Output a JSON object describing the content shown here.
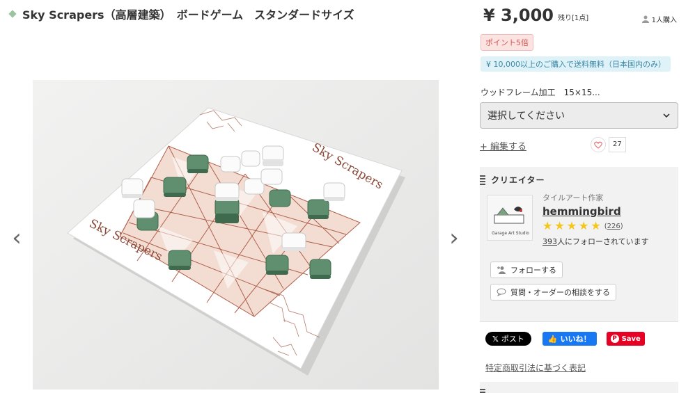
{
  "product": {
    "title": "Sky Scrapers（高層建築）　ボードゲーム　スタンダードサイズ"
  },
  "gallery": {
    "prev_glyph": "‹",
    "next_glyph": "›",
    "board_text_1": "Sky Scrapers",
    "board_text_2": "Sky Scrapers"
  },
  "purchase": {
    "price": "¥ 3,000",
    "stock": "残り[1点]",
    "buyers": "1人購入",
    "point_badge": "ポイント5倍",
    "shipping_note": "¥ 10,000以上のご購入で送料無料（日本国内のみ）",
    "option_label": "ウッドフレーム加工　15×15...",
    "select_value": "選択してください",
    "edit_link": "+ 編集する",
    "favorite_count": "27"
  },
  "creator": {
    "heading": "クリエイター",
    "role": "タイルアート作家",
    "name": "hemmingbird",
    "stars": [
      "★",
      "★",
      "★",
      "★",
      "★"
    ],
    "review_open": "(",
    "review_count": "226",
    "review_close": ")",
    "follower_count": "393",
    "follower_suffix": "人にフォローされています",
    "follow_button": "フォローする",
    "consult_button": "質問・オーダーの相談をする",
    "avatar_text": "Garage Art Studio"
  },
  "share": {
    "x_glyph": "𝕏",
    "x_label": "ポスト",
    "like_glyph": "👍",
    "like_label": "いいね！",
    "pin_glyph": "P",
    "save_label": "Save"
  },
  "footer": {
    "legal_link": "特定商取引法に基づく表記"
  },
  "colors": {
    "brand_green": "#9bc5a0",
    "badge_red": "#d9534f",
    "info_blue": "#3a88a8",
    "star_yellow": "#f5c518",
    "facebook_blue": "#1877f2",
    "pinterest_red": "#e60023"
  },
  "icons": [
    "diamond-icon",
    "person-icon",
    "chevron-down-icon",
    "heart-icon",
    "stripe-icon",
    "follow-user-icon",
    "speech-bubble-icon",
    "x-logo-icon",
    "thumbs-up-icon",
    "pinterest-icon"
  ]
}
